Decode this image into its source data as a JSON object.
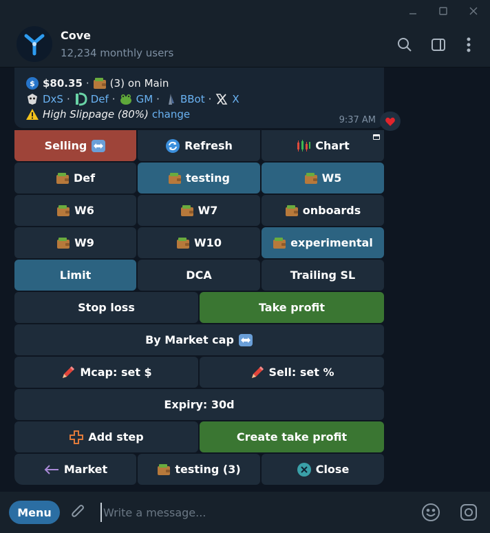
{
  "chat": {
    "title": "Cove",
    "subtitle": "12,234 monthly users"
  },
  "message": {
    "balance": "$80.35",
    "wallet_count": "(3)",
    "on_label": "on",
    "wallet_name": "Main",
    "sep": "·",
    "links": [
      "DxS",
      "Def",
      "GM",
      "BBot",
      "X"
    ],
    "warning": "High Slippage (80%)",
    "warning_action": "change",
    "time": "9:37 AM",
    "reaction": "heart"
  },
  "keyboard": {
    "selling": "Selling",
    "refresh": "Refresh",
    "chart": "Chart",
    "def": "Def",
    "testing": "testing",
    "w5": "W5",
    "w6": "W6",
    "w7": "W7",
    "onboards": "onboards",
    "w9": "W9",
    "w10": "W10",
    "experimental": "experimental",
    "limit": "Limit",
    "dca": "DCA",
    "trailing_sl": "Trailing SL",
    "stop_loss": "Stop loss",
    "take_profit": "Take profit",
    "by_market_cap": "By Market cap",
    "mcap_set": "Mcap: set $",
    "sell_set": "Sell: set %",
    "expiry": "Expiry: 30d",
    "add_step": "Add step",
    "create_take_profit": "Create take profit",
    "market": "Market",
    "testing_count": "testing (3)",
    "close": "Close"
  },
  "composer": {
    "menu_label": "Menu",
    "placeholder": "Write a message..."
  },
  "colors": {
    "background": "#0e1621",
    "panel": "#17212b",
    "button": "#1e2c3a",
    "selected_blue": "#2c6381",
    "selling_red": "#9e4439",
    "profit_green": "#3a7632",
    "link": "#6ab3f3",
    "menu_blue": "#2b6ea3"
  }
}
